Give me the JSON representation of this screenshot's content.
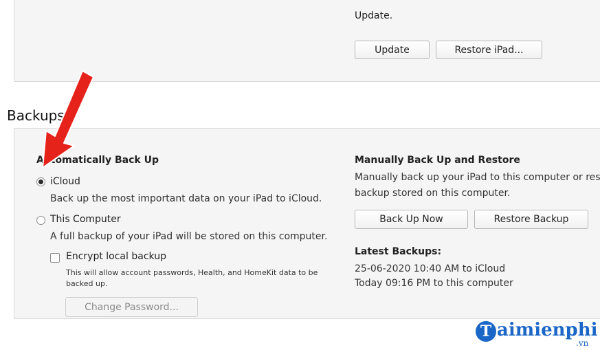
{
  "update_section": {
    "text_tail": "Update.",
    "update_button": "Update",
    "restore_button": "Restore iPad..."
  },
  "backups": {
    "title": "Backups",
    "auto": {
      "heading": "Automatically Back Up",
      "icloud_label": "iCloud",
      "icloud_selected": true,
      "icloud_desc": "Back up the most important data on your iPad to iCloud.",
      "computer_label": "This Computer",
      "computer_desc": "A full backup of your iPad will be stored on this computer.",
      "encrypt_label": "Encrypt local backup",
      "encrypt_checked": false,
      "encrypt_desc": "This will allow account passwords, Health, and HomeKit data to be backed up.",
      "change_password_button": "Change Password..."
    },
    "manual": {
      "heading": "Manually Back Up and Restore",
      "desc_line1": "Manually back up your iPad to this computer or res",
      "desc_line2": "backup stored on this computer.",
      "backup_now_button": "Back Up Now",
      "restore_backup_button": "Restore Backup"
    },
    "latest": {
      "heading": "Latest Backups:",
      "icloud": "25-06-2020 10:40 AM to iCloud",
      "computer": "Today 09:16 PM to this computer"
    }
  },
  "watermark": {
    "logo_letter": "T",
    "text": "aimienphi",
    "suffix": ".vn"
  },
  "colors": {
    "accent": "#2f7de0",
    "arrow": "#e5231b",
    "watermark": "#1b67c8"
  }
}
